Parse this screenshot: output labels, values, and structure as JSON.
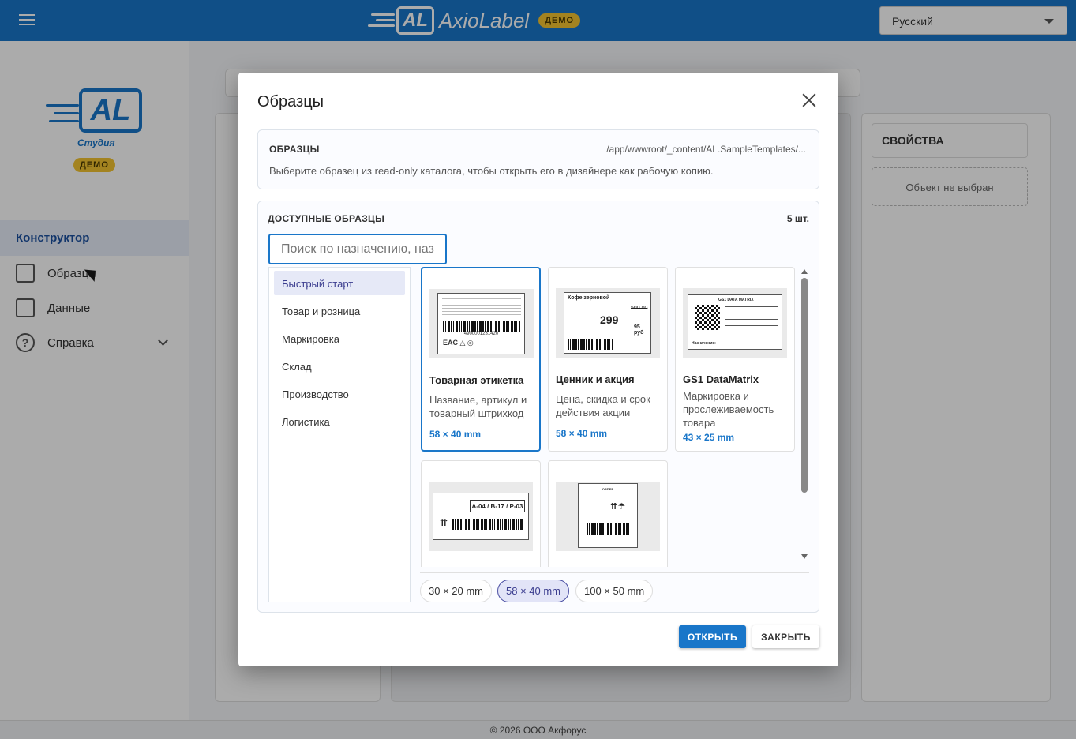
{
  "header": {
    "brand_logo": "AL",
    "brand_name": "AxioLabel",
    "brand_badge": "ДЕМО",
    "language": "Русский"
  },
  "sidebar": {
    "logo": "AL",
    "studio": "Студия",
    "badge": "ДЕМО",
    "active_item": "Конструктор",
    "items": [
      {
        "label": "Образцы",
        "icon": "library-icon"
      },
      {
        "label": "Данные",
        "icon": "table-icon"
      },
      {
        "label": "Справка",
        "icon": "help-icon"
      }
    ]
  },
  "properties": {
    "title": "СВОЙСТВА",
    "empty": "Объект не выбран"
  },
  "footer": "© 2026 ООО Акфорус",
  "modal": {
    "title": "Образцы",
    "info": {
      "label": "ОБРАЗЦЫ",
      "path": "/app/wwwroot/_content/AL.SampleTemplates/...",
      "description": "Выберите образец из read-only каталога, чтобы открыть его в дизайнере как рабочую копию."
    },
    "available": {
      "label": "ДОСТУПНЫЕ ОБРАЗЦЫ",
      "count": "5 шт.",
      "search_placeholder": "Поиск по назначению, наз",
      "categories": [
        "Быстрый старт",
        "Товар и розница",
        "Маркировка",
        "Склад",
        "Производство",
        "Логистика"
      ],
      "cards": [
        {
          "title": "Товарная этикетка",
          "desc": "Название, артикул и товарный штрихкод",
          "size": "58 × 40 mm",
          "thumb_code": "4900001231420"
        },
        {
          "title": "Ценник и акция",
          "desc": "Цена, скидка и срок действия акции",
          "size": "58 × 40 mm",
          "thumb_head": "Кофе зерновой",
          "thumb_price": "299",
          "thumb_old": "500.00",
          "thumb_new": "95 руб"
        },
        {
          "title": "GS1 DataMatrix",
          "desc": "Маркировка и прослеживаемость товара",
          "size": "43 × 25 mm",
          "thumb_head": "GS1 DATA MATRIX",
          "thumb_name": "Назначение:"
        },
        {
          "thumb_loc": "A-04 / B-17 / P-03"
        },
        {
          "thumb_head": "ORDER"
        }
      ],
      "sizes": [
        "30 × 20 mm",
        "58 × 40 mm",
        "100 × 50 mm"
      ]
    },
    "buttons": {
      "open": "ОТКРЫТЬ",
      "close": "ЗАКРЫТЬ"
    }
  }
}
